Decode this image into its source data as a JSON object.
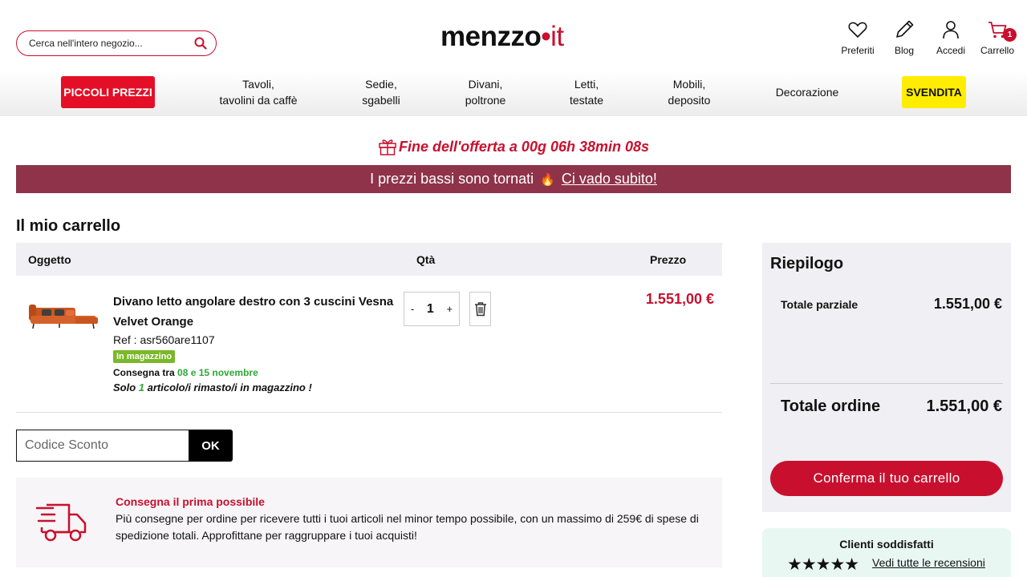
{
  "header": {
    "search_placeholder": "Cerca nell'intero negozio...",
    "logo_main": "menzzo",
    "logo_tld": "it",
    "icons": [
      {
        "label": "Preferiti",
        "icon": "heart-icon"
      },
      {
        "label": "Blog",
        "icon": "pencil-icon"
      },
      {
        "label": "Accedi",
        "icon": "user-icon"
      },
      {
        "label": "Carrello",
        "icon": "cart-icon"
      }
    ],
    "cart_count": "1"
  },
  "nav": {
    "promo_left": "PICCOLI PREZZI",
    "items": [
      {
        "line1": "Tavoli,",
        "line2": "tavolini da caffè"
      },
      {
        "line1": "Sedie,",
        "line2": "sgabelli"
      },
      {
        "line1": "Divani,",
        "line2": "poltrone"
      },
      {
        "line1": "Letti,",
        "line2": "testate"
      },
      {
        "line1": "Mobili,",
        "line2": "deposito"
      },
      {
        "line1": "Decorazione",
        "line2": ""
      }
    ],
    "promo_right": "SVENDITA"
  },
  "offer": {
    "text": "Fine dell'offerta a 00g 06h 38min 08s"
  },
  "banner": {
    "text": "I prezzi bassi sono tornati",
    "emoji": "🔥",
    "link": "Ci vado subito!"
  },
  "cart": {
    "title": "Il mio carrello",
    "headers": {
      "item": "Oggetto",
      "qty": "Qtà",
      "price": "Prezzo"
    },
    "product": {
      "name": "Divano letto angolare destro con 3 cuscini Vesna Velvet Orange",
      "ref": "Ref : asr560are1107",
      "stock": "In magazzino",
      "delivery_prefix": "Consegna tra ",
      "delivery_dates": "08 e 15 novembre",
      "remaining_prefix": "Solo ",
      "remaining_count": "1",
      "remaining_suffix": " articolo/i rimasto/i in magazzino !",
      "qty": "1",
      "minus": "-",
      "plus": "+",
      "price": "1.551,00 €"
    },
    "coupon_placeholder": "Codice Sconto",
    "coupon_button": "OK",
    "shipping_title": "Consegna il prima possibile",
    "shipping_text": "Più consegne per ordine per ricevere tutti i tuoi articoli nel minor tempo possibile, con un massimo di 259€ di spese di spedizione totali. Approfittane per raggruppare i tuoi acquisti!"
  },
  "summary": {
    "title": "Riepilogo",
    "subtotal_label": "Totale parziale",
    "subtotal_value": "1.551,00 €",
    "total_label": "Totale ordine",
    "total_value": "1.551,00 €",
    "confirm": "Conferma il tuo carrello"
  },
  "reviews": {
    "title": "Clienti soddisfatti",
    "stars": "★★★★★",
    "link": "Vedi tutte le recensioni"
  },
  "colors": {
    "accent": "#c8102e",
    "banner": "#8e3349",
    "promo_red": "#e40f26",
    "promo_yellow": "#ffed00",
    "stock_green": "#7ab829"
  }
}
